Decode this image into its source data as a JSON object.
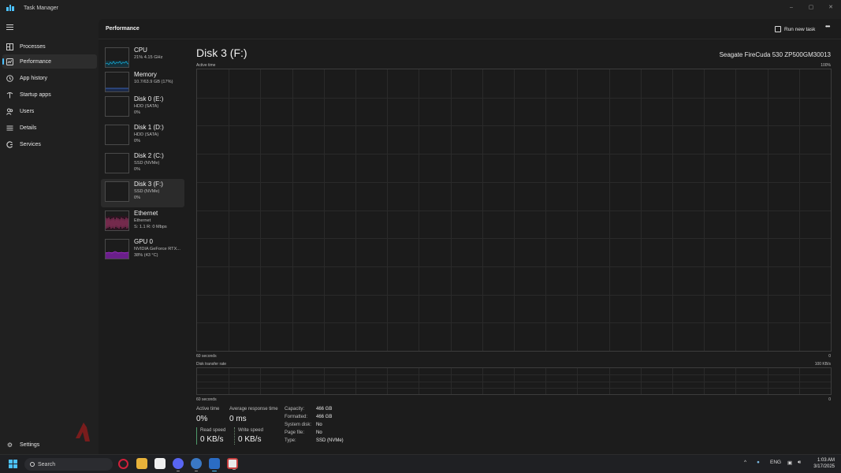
{
  "window": {
    "title": "Task Manager",
    "controls": {
      "minimize": "–",
      "maximize": "▢",
      "close": "✕"
    }
  },
  "sidebar": {
    "items": [
      {
        "label": "Processes",
        "icon": "processes-icon",
        "active": false
      },
      {
        "label": "Performance",
        "icon": "performance-icon",
        "active": true
      },
      {
        "label": "App history",
        "icon": "app-history-icon",
        "active": false
      },
      {
        "label": "Startup apps",
        "icon": "startup-apps-icon",
        "active": false
      },
      {
        "label": "Users",
        "icon": "users-icon",
        "active": false
      },
      {
        "label": "Details",
        "icon": "details-icon",
        "active": false
      },
      {
        "label": "Services",
        "icon": "services-icon",
        "active": false
      }
    ],
    "settings_label": "Settings"
  },
  "header": {
    "title": "Performance",
    "run_new_task": "Run new task",
    "more": "•••"
  },
  "devices": [
    {
      "name": "CPU",
      "line1": "21% 4.15 GHz",
      "line2": "",
      "color": "#17a2c9"
    },
    {
      "name": "Memory",
      "line1": "10.7/63.9 GB (17%)",
      "line2": "",
      "color": "#4477dd"
    },
    {
      "name": "Disk 0 (E:)",
      "line1": "HDD (SATA)",
      "line2": "0%",
      "color": "#6bbf3b"
    },
    {
      "name": "Disk 1 (D:)",
      "line1": "HDD (SATA)",
      "line2": "0%",
      "color": "#6bbf3b"
    },
    {
      "name": "Disk 2 (C:)",
      "line1": "SSD (NVMe)",
      "line2": "0%",
      "color": "#6bbf3b"
    },
    {
      "name": "Disk 3 (F:)",
      "line1": "SSD (NVMe)",
      "line2": "0%",
      "color": "#6bbf3b",
      "active": true
    },
    {
      "name": "Ethernet",
      "line1": "Ethernet",
      "line2": "S: 1.1 R: 0 Mbps",
      "color": "#c0407a"
    },
    {
      "name": "GPU 0",
      "line1": "NVIDIA GeForce RTX...",
      "line2": "38% (43 °C)",
      "color": "#a030c8"
    }
  ],
  "detail": {
    "title": "Disk 3 (F:)",
    "model": "Seagate FireCuda 530 ZP500GM30013",
    "active_time_graph": {
      "label": "Active time",
      "max_label": "100%",
      "x_left_label": "60 seconds",
      "x_right_label": "0"
    },
    "transfer_graph": {
      "label": "Disk transfer rate",
      "max_label": "100 KB/s",
      "x_left_label": "60 seconds",
      "x_right_label": "0"
    },
    "stats": {
      "active_time_label": "Active time",
      "active_time_value": "0%",
      "avg_response_label": "Average response time",
      "avg_response_value": "0 ms",
      "read_speed_label": "Read speed",
      "read_speed_value": "0 KB/s",
      "write_speed_label": "Write speed",
      "write_speed_value": "0 KB/s"
    },
    "properties": [
      {
        "key": "Capacity:",
        "value": "466 GB"
      },
      {
        "key": "Formatted:",
        "value": "466 GB"
      },
      {
        "key": "System disk:",
        "value": "No"
      },
      {
        "key": "Page file:",
        "value": "No"
      },
      {
        "key": "Type:",
        "value": "SSD (NVMe)"
      }
    ]
  },
  "taskbar": {
    "search_placeholder": "Search",
    "apps": [
      "opera-icon",
      "file-explorer-icon",
      "microsoft-store-icon",
      "discord-icon",
      "settings-app-icon",
      "task-manager-icon",
      "snipping-tool-icon"
    ],
    "tray": {
      "language": "ENG",
      "time": "1:03 AM",
      "date": "3/17/2025"
    }
  }
}
